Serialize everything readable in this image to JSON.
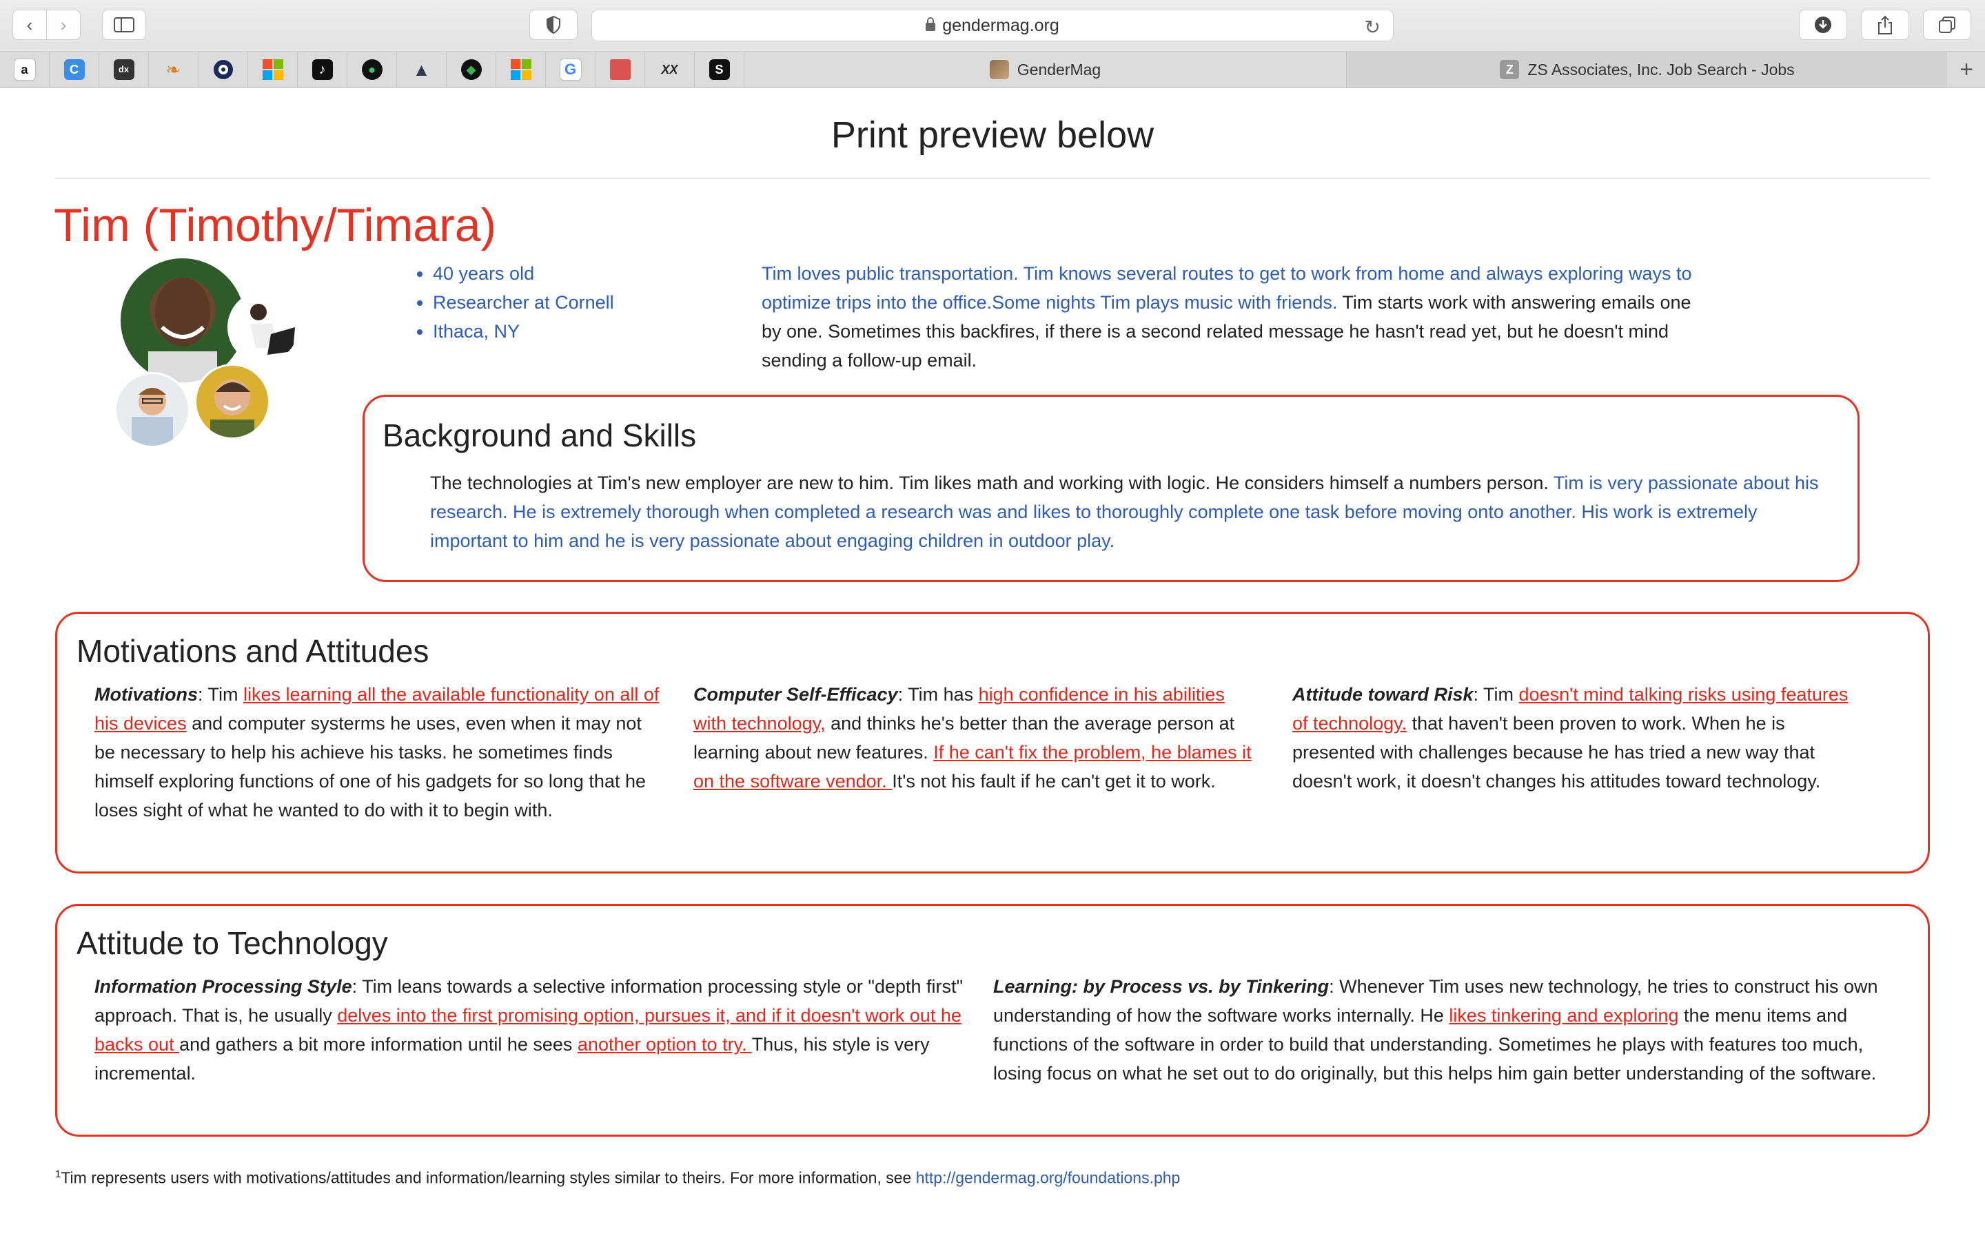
{
  "browser": {
    "url": "gendermag.org",
    "tabs": [
      {
        "label": "GenderMag",
        "active": true
      },
      {
        "label": "ZS Associates, Inc. Job Search - Jobs",
        "active": false
      }
    ],
    "favorites": [
      "amazon",
      "c",
      "dx",
      "feather",
      "circle",
      "microsoft",
      "tiktok",
      "green-circle",
      "mountain",
      "leaf",
      "microsoft",
      "google",
      "red-square",
      "xx",
      "s"
    ],
    "favorite_letters": {
      "amazon": "a",
      "c": "C",
      "dx": "dx",
      "xx": "XX",
      "s": "S",
      "google": "G"
    }
  },
  "page": {
    "preview_title": "Print preview below",
    "persona_name": "Tim (Timothy/Timara)",
    "facts": [
      "40 years old",
      "Researcher at Cornell",
      "Ithaca, NY"
    ],
    "intro_blue": "Tim loves public transportation. Tim knows several routes to get to work from home and always exploring ways to optimize trips into the office.Some nights Tim plays music with friends.",
    "intro_black": " Tim starts work with answering emails one by one. Sometimes this backfires, if there is a second related message he hasn't read yet, but he doesn't mind sending a follow-up email."
  },
  "background": {
    "heading": "Background and Skills",
    "text_black": "The technologies at Tim's new employer are new to him. Tim likes math and working with logic. He considers himself a numbers person. ",
    "text_blue": "Tim is very passionate about his research. He is extremely thorough when completed a research was and likes to thoroughly complete one task before moving onto another. His work is extremely important to him and he is very passionate about engaging children in outdoor play."
  },
  "motivations": {
    "heading": "Motivations and Attitudes",
    "cols": [
      {
        "label": "Motivations",
        "pre": ": Tim ",
        "hl": "likes learning all the available functionality on all of his devices",
        "post": " and computer systerms he uses, even when it may not be necessary to help his achieve his tasks. he sometimes finds himself exploring functions of one of his gadgets for so long that he loses sight of what he wanted to do with it to begin with.",
        "hl2": "",
        "post2": ""
      },
      {
        "label": "Computer Self-Efficacy",
        "pre": ": Tim has ",
        "hl": "high confidence in his abilities with technology,",
        "post": " and thinks he's better than the average person at learning about new features. ",
        "hl2": "If he can't fix the problem, he blames it on the software vendor. ",
        "post2": "It's not his fault if he can't get it to work."
      },
      {
        "label": "Attitude toward Risk",
        "pre": ": Tim ",
        "hl": "doesn't mind talking risks using features of technology.",
        "post": " that haven't been proven to work. When he is presented with challenges because he has tried a new way that doesn't work, it doesn't changes his attitudes toward technology.",
        "hl2": "",
        "post2": ""
      }
    ]
  },
  "technology": {
    "heading": "Attitude to Technology",
    "cols": [
      {
        "label": "Information Processing Style",
        "pre": ": Tim leans towards a selective information processing style or \"depth first\" approach. That is, he usually ",
        "hl": "delves into the first promising option, pursues it, and if it doesn't work out he backs out ",
        "post": "and gathers a bit more information until he sees ",
        "hl2": "another option to try. ",
        "post2": "Thus, his style is very incremental."
      },
      {
        "label": "Learning: by Process vs. by Tinkering",
        "pre": ": Whenever Tim uses new technology, he tries to construct his own understanding of how the software works internally. He ",
        "hl": "likes tinkering and exploring",
        "post": " the menu items and functions of the software in order to build that understanding. Sometimes he plays with features too much, losing focus on what he set out to do originally, but this helps him gain better understanding of the software.",
        "hl2": "",
        "post2": ""
      }
    ]
  },
  "footnote": {
    "sup": "1",
    "text": "Tim represents users with motivations/attitudes and information/learning styles similar to theirs. For more information, see ",
    "link": "http://gendermag.org/foundations.php"
  }
}
